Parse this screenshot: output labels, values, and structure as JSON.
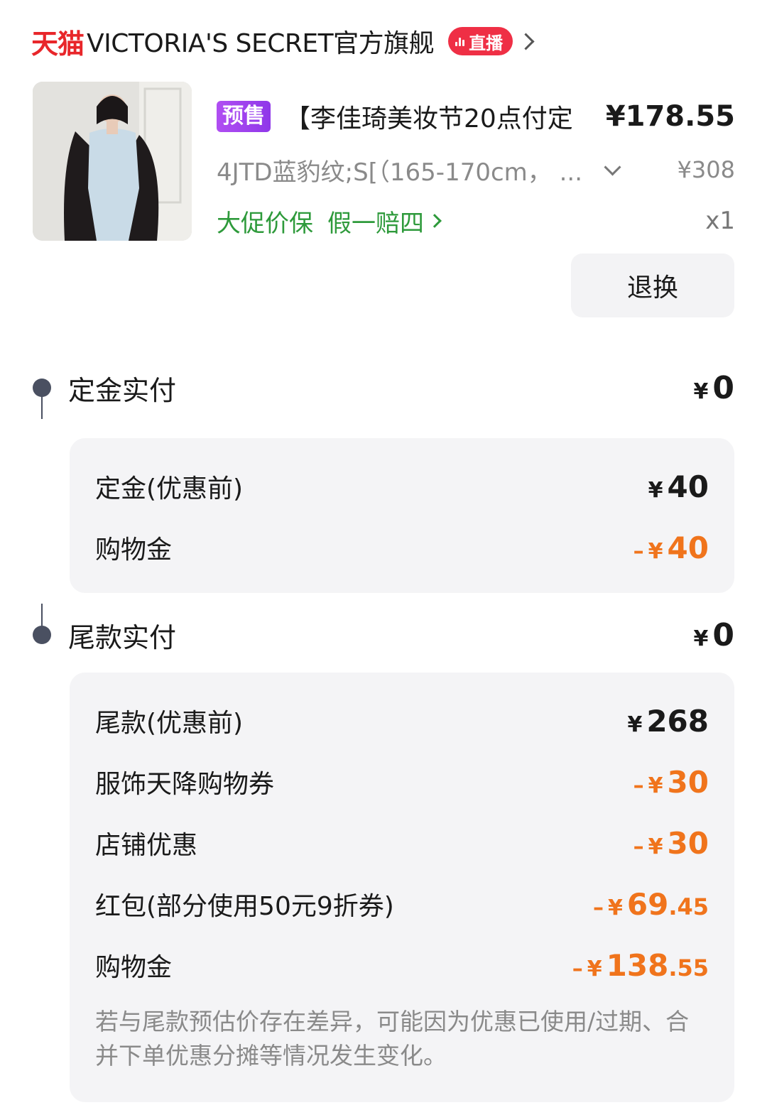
{
  "store": {
    "platform_logo": "天猫",
    "name": "VICTORIA'S SECRET官方旗舰",
    "live_badge": "直播"
  },
  "product": {
    "presale_tag": "预售",
    "title": "【李佳琦美妆节20点付定",
    "price": "¥178.55",
    "sku": "4JTD蓝豹纹;S[（165-170cm， ...",
    "original_price": "¥308",
    "service_tags": [
      "大促价保",
      "假一赔四"
    ],
    "quantity": "x1",
    "return_button": "退换"
  },
  "deposit_section": {
    "title": "定金实付",
    "currency": "¥",
    "amount": "0",
    "rows": [
      {
        "label": "定金(优惠前)",
        "sign": "",
        "currency": "¥",
        "value": "40",
        "decimal": ""
      },
      {
        "label": "购物金",
        "sign": "–",
        "currency": "¥",
        "value": "40",
        "decimal": ""
      }
    ]
  },
  "balance_section": {
    "title": "尾款实付",
    "currency": "¥",
    "amount": "0",
    "rows": [
      {
        "label": "尾款(优惠前)",
        "sign": "",
        "currency": "¥",
        "value": "268",
        "decimal": ""
      },
      {
        "label": "服饰天降购物券",
        "sign": "–",
        "currency": "¥",
        "value": "30",
        "decimal": ""
      },
      {
        "label": "店铺优惠",
        "sign": "–",
        "currency": "¥",
        "value": "30",
        "decimal": ""
      },
      {
        "label": "红包(部分使用50元9折券)",
        "sign": "–",
        "currency": "¥",
        "value": "69",
        "decimal": ".45"
      },
      {
        "label": "购物金",
        "sign": "–",
        "currency": "¥",
        "value": "138",
        "decimal": ".55"
      }
    ],
    "note": "若与尾款预估价存在差异，可能因为优惠已使用/过期、合并下单优惠分摊等情况发生变化。"
  },
  "colors": {
    "tmall_red": "#e8262a",
    "live_badge": "#ef2f45",
    "presale_purple": "#9b40ee",
    "service_green": "#2e9a3b",
    "discount_orange": "#f0741c",
    "card_bg": "#f4f4f6"
  }
}
